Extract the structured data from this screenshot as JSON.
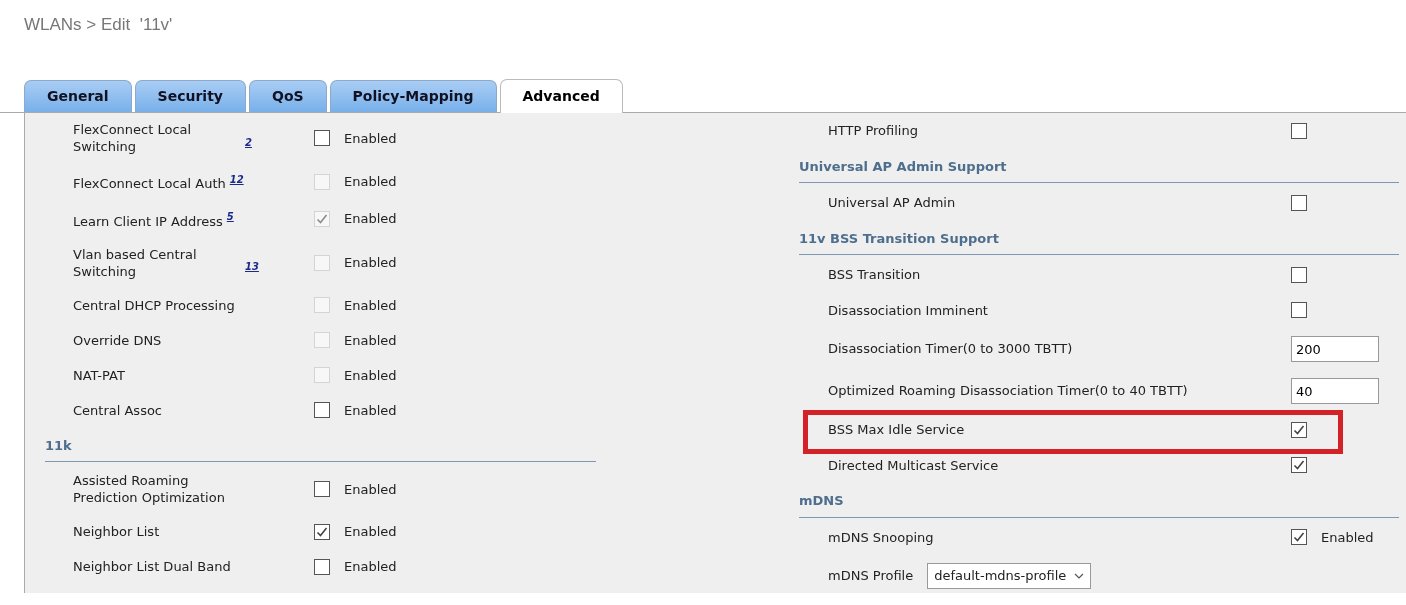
{
  "title": "WLANs > Edit  '11v'",
  "tabs": [
    {
      "label": "General",
      "selected": false
    },
    {
      "label": "Security",
      "selected": false
    },
    {
      "label": "QoS",
      "selected": false
    },
    {
      "label": "Policy-Mapping",
      "selected": false
    },
    {
      "label": "Advanced",
      "selected": true
    }
  ],
  "left": {
    "rows": [
      {
        "kind": "checkbox",
        "label": "FlexConnect Local Switching",
        "footnote": "2",
        "checked": false,
        "disabled": false,
        "suffix": "Enabled"
      },
      {
        "kind": "checkbox",
        "label": "FlexConnect Local Auth",
        "footnote": "12",
        "checked": false,
        "disabled": true,
        "suffix": "Enabled"
      },
      {
        "kind": "checkbox",
        "label": "Learn Client IP Address",
        "footnote": "5",
        "checked": true,
        "disabled": true,
        "suffix": "Enabled"
      },
      {
        "kind": "checkbox",
        "label": "Vlan based Central Switching",
        "footnote": "13",
        "checked": false,
        "disabled": true,
        "suffix": "Enabled"
      },
      {
        "kind": "checkbox",
        "label": "Central DHCP Processing",
        "checked": false,
        "disabled": true,
        "suffix": "Enabled"
      },
      {
        "kind": "checkbox",
        "label": "Override DNS",
        "checked": false,
        "disabled": true,
        "suffix": "Enabled"
      },
      {
        "kind": "checkbox",
        "label": "NAT-PAT",
        "checked": false,
        "disabled": true,
        "suffix": "Enabled"
      },
      {
        "kind": "checkbox",
        "label": "Central Assoc",
        "checked": false,
        "disabled": false,
        "suffix": "Enabled"
      },
      {
        "kind": "heading",
        "label": "11k"
      },
      {
        "kind": "checkbox",
        "label": "Assisted Roaming Prediction Optimization",
        "checked": false,
        "disabled": false,
        "suffix": "Enabled"
      },
      {
        "kind": "checkbox",
        "label": "Neighbor List",
        "checked": true,
        "disabled": false,
        "suffix": "Enabled"
      },
      {
        "kind": "checkbox",
        "label": "Neighbor List Dual Band",
        "checked": false,
        "disabled": false,
        "suffix": "Enabled"
      }
    ]
  },
  "right": {
    "rows": [
      {
        "kind": "checkbox",
        "label": "HTTP Profiling",
        "checked": false,
        "highlighted": false
      },
      {
        "kind": "heading",
        "label": "Universal AP Admin Support"
      },
      {
        "kind": "checkbox",
        "label": "Universal AP Admin",
        "checked": false,
        "highlighted": false
      },
      {
        "kind": "heading",
        "label": "11v BSS Transition Support"
      },
      {
        "kind": "checkbox",
        "label": "BSS Transition",
        "checked": false,
        "highlighted": false
      },
      {
        "kind": "checkbox",
        "label": "Disassociation Imminent",
        "checked": false,
        "highlighted": false
      },
      {
        "kind": "input",
        "label": "Disassociation Timer(0 to 3000 TBTT)",
        "value": "200"
      },
      {
        "kind": "input",
        "label": "Optimized Roaming Disassociation Timer(0 to 40 TBTT)",
        "value": "40"
      },
      {
        "kind": "checkbox",
        "label": "BSS Max Idle Service",
        "checked": true,
        "highlighted": true
      },
      {
        "kind": "checkbox",
        "label": "Directed Multicast Service",
        "checked": true,
        "highlighted": false
      },
      {
        "kind": "heading",
        "label": "mDNS"
      },
      {
        "kind": "checkbox",
        "label": "mDNS Snooping",
        "checked": true,
        "highlighted": false,
        "suffix": "Enabled"
      },
      {
        "kind": "select",
        "label": "mDNS Profile",
        "value": "default-mdns-profile"
      }
    ]
  }
}
